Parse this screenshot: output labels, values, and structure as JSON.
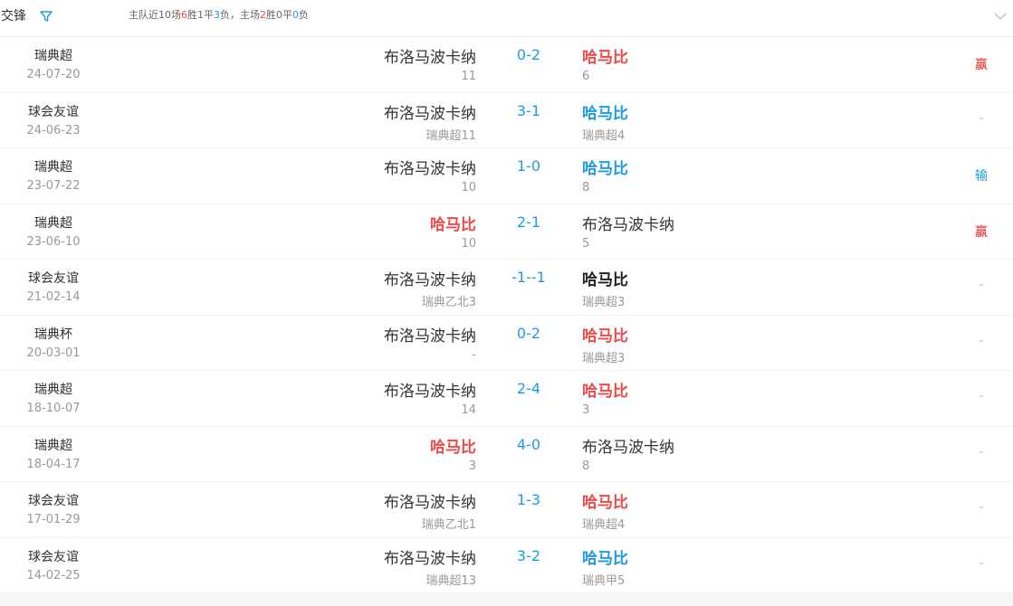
{
  "header": {
    "title": "交锋",
    "summary": {
      "prefix": "主队近10场",
      "wins": "6",
      "wins_label": "胜",
      "draws": "1",
      "draws_label": "平",
      "losses": "3",
      "losses_label": "负",
      "home_prefix": "，主场",
      "home_wins": "2",
      "home_wins_label": "胜",
      "home_draws": "0",
      "home_draws_label": "平",
      "home_losses": "0",
      "home_losses_label": "负"
    }
  },
  "icons": {
    "filter": "filter-icon",
    "collapse": "chevron-down-icon"
  },
  "colors": {
    "win_red": "#f04848",
    "loss_blue": "#1e9be6",
    "text": "#333333",
    "muted": "#999999"
  },
  "matches": [
    {
      "league": "瑞典超",
      "date": "24-07-20",
      "home": "布洛马波卡纳",
      "home_sub": "11",
      "score": "0-2",
      "away": "哈马比",
      "away_sub": "6",
      "result": "赢",
      "home_hl": "",
      "away_hl": "red",
      "result_type": "win"
    },
    {
      "league": "球会友谊",
      "date": "24-06-23",
      "home": "布洛马波卡纳",
      "home_sub": "瑞典超11",
      "score": "3-1",
      "away": "哈马比",
      "away_sub": "瑞典超4",
      "result": "-",
      "home_hl": "",
      "away_hl": "blue",
      "result_type": "none"
    },
    {
      "league": "瑞典超",
      "date": "23-07-22",
      "home": "布洛马波卡纳",
      "home_sub": "10",
      "score": "1-0",
      "away": "哈马比",
      "away_sub": "8",
      "result": "输",
      "home_hl": "",
      "away_hl": "blue",
      "result_type": "loss"
    },
    {
      "league": "瑞典超",
      "date": "23-06-10",
      "home": "哈马比",
      "home_sub": "10",
      "score": "2-1",
      "away": "布洛马波卡纳",
      "away_sub": "5",
      "result": "赢",
      "home_hl": "red",
      "away_hl": "",
      "result_type": "win"
    },
    {
      "league": "球会友谊",
      "date": "21-02-14",
      "home": "布洛马波卡纳",
      "home_sub": "瑞典乙北3",
      "score": "-1--1",
      "away": "哈马比",
      "away_sub": "瑞典超3",
      "result": "-",
      "home_hl": "",
      "away_hl": "black",
      "result_type": "none"
    },
    {
      "league": "瑞典杯",
      "date": "20-03-01",
      "home": "布洛马波卡纳",
      "home_sub": "-",
      "score": "0-2",
      "away": "哈马比",
      "away_sub": "瑞典超3",
      "result": "-",
      "home_hl": "",
      "away_hl": "red",
      "result_type": "none"
    },
    {
      "league": "瑞典超",
      "date": "18-10-07",
      "home": "布洛马波卡纳",
      "home_sub": "14",
      "score": "2-4",
      "away": "哈马比",
      "away_sub": "3",
      "result": "-",
      "home_hl": "",
      "away_hl": "red",
      "result_type": "none"
    },
    {
      "league": "瑞典超",
      "date": "18-04-17",
      "home": "哈马比",
      "home_sub": "3",
      "score": "4-0",
      "away": "布洛马波卡纳",
      "away_sub": "8",
      "result": "-",
      "home_hl": "red",
      "away_hl": "",
      "result_type": "none"
    },
    {
      "league": "球会友谊",
      "date": "17-01-29",
      "home": "布洛马波卡纳",
      "home_sub": "瑞典乙北1",
      "score": "1-3",
      "away": "哈马比",
      "away_sub": "瑞典超4",
      "result": "-",
      "home_hl": "",
      "away_hl": "red",
      "result_type": "none"
    },
    {
      "league": "球会友谊",
      "date": "14-02-25",
      "home": "布洛马波卡纳",
      "home_sub": "瑞典超13",
      "score": "3-2",
      "away": "哈马比",
      "away_sub": "瑞典甲5",
      "result": "-",
      "home_hl": "",
      "away_hl": "blue",
      "result_type": "none"
    }
  ]
}
